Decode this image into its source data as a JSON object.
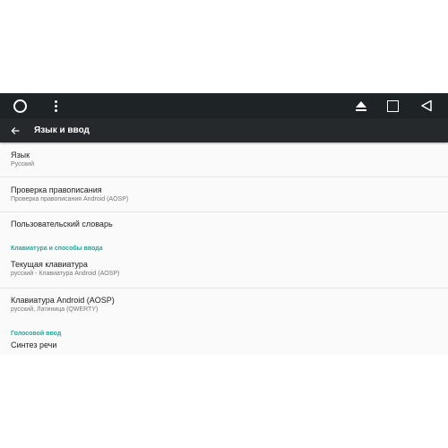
{
  "nav_bar": {
    "home_icon": "circle-icon",
    "menu_icon": "more-vertical-icon",
    "eject_icon": "eject-icon",
    "recents_icon": "square-icon",
    "back_icon": "back-triangle-icon",
    "color": "#1e2326"
  },
  "app_bar": {
    "title": "Язык и ввод",
    "back_icon": "arrow-back-icon",
    "color": "#26292b"
  },
  "accent_color": "#26a69a",
  "settings": {
    "language": {
      "title": "Язык",
      "summary": "Русский"
    },
    "spell_check": {
      "title": "Проверка правописания",
      "summary": "Проверка правописания Android (AOSP)"
    },
    "user_dictionary": {
      "title": "Пользовательский словарь"
    },
    "keyboard_header": "Клавиатура и способы ввода",
    "current_keyboard": {
      "title": "Текущая клавиатура",
      "summary": "русский - Клавиатура Android (AOSP)"
    },
    "android_keyboard": {
      "title": "Клавиатура Android (AOSP)",
      "summary": "русский, Латиница (QWERTY)"
    },
    "voice_header": "Голосовой ввод",
    "speech_synthesis": {
      "title": "Синтез речи"
    }
  }
}
